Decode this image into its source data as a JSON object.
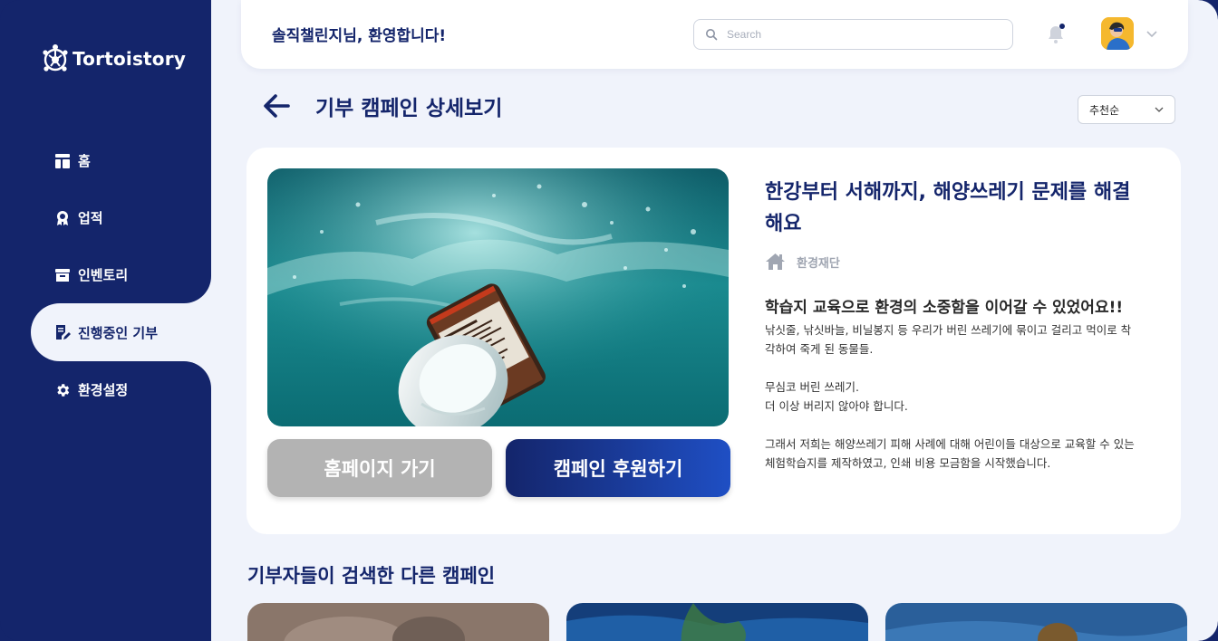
{
  "brand": {
    "name": "Tortoistory"
  },
  "sidebar": {
    "items": [
      {
        "label": "홈",
        "icon": "home-grid-icon",
        "active": false
      },
      {
        "label": "업적",
        "icon": "medal-icon",
        "active": false
      },
      {
        "label": "인벤토리",
        "icon": "archive-box-icon",
        "active": false
      },
      {
        "label": "진행중인 기부",
        "icon": "document-edit-icon",
        "active": true
      },
      {
        "label": "환경설정",
        "icon": "gear-icon",
        "active": false
      }
    ]
  },
  "header": {
    "welcome": "솔직챌린지님, 환영합니다!",
    "search_placeholder": "Search",
    "search_value": ""
  },
  "page": {
    "title": "기부 캠페인 상세보기",
    "sort_selected": "추천순"
  },
  "campaign": {
    "title": "한강부터 서해까지, 해양쓰레기 문제를 해결해요",
    "organization": "환경재단",
    "subheading": "학습지 교육으로 환경의 소중함을 이어갈 수 있었어요!!",
    "description": "낚싯줄, 낚싯바늘, 비닐봉지 등 우리가 버린 쓰레기에 묶이고 걸리고 먹이로 착각하여 죽게 된 동물들.\n\n무심코 버린 쓰레기.\n더 이상 버리지 않아야 합니다.\n\n그래서 저희는 해양쓰레기 피해 사례에 대해 어린이들 대상으로 교육할 수 있는 체험학습지를 제작하였고, 인쇄 비용 모금함을 시작했습니다.",
    "home_button": "홈페이지 가기",
    "donate_button": "캠페인 후원하기"
  },
  "related": {
    "title": "기부자들이 검색한 다른 캠페인"
  },
  "colors": {
    "navy": "#14256b",
    "background": "#f0f3fb",
    "button_gray": "#b3b3b3",
    "button_blue": "#1f4fc4"
  }
}
